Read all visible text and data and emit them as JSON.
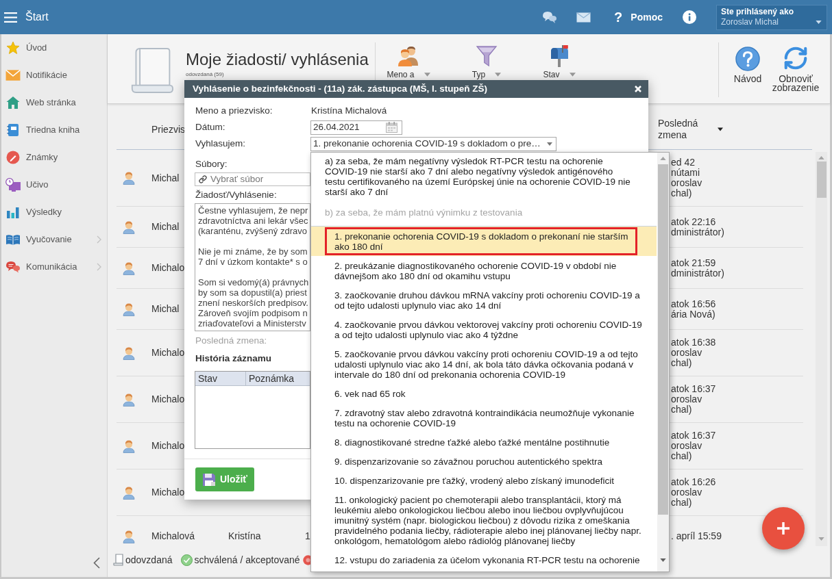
{
  "top_bar": {
    "title": "Štart",
    "help": {
      "symbol": "?",
      "label": "Pomoc"
    },
    "user": {
      "caption": "Ste prihlásený ako",
      "name": "Zoroslav Michal"
    }
  },
  "sidebar": {
    "items": [
      {
        "label": "Úvod",
        "submenu": false
      },
      {
        "label": "Notifikácie",
        "submenu": false
      },
      {
        "label": "Web stránka",
        "submenu": false
      },
      {
        "label": "Triedna kniha",
        "submenu": false
      },
      {
        "label": "Známky",
        "submenu": false
      },
      {
        "label": "Učivo",
        "submenu": false
      },
      {
        "label": "Výsledky",
        "submenu": false
      },
      {
        "label": "Vyučovanie",
        "submenu": true
      },
      {
        "label": "Komunikácia",
        "submenu": true
      }
    ]
  },
  "header": {
    "title": "Moje žiadosti/ vyhlásenia",
    "subtitle": "odovzdaná (59)",
    "filters": [
      {
        "label": "Meno a"
      },
      {
        "label": "Typ"
      },
      {
        "label": "Stav"
      }
    ],
    "actions": [
      {
        "label": "Návod"
      },
      {
        "label": "Obnoviť zobrazenie"
      }
    ]
  },
  "table": {
    "columns": [
      {
        "label": "Priezvis"
      },
      {
        "label": "Posledná zmena",
        "sorted": true
      }
    ],
    "rows": [
      {
        "surname": "Michal",
        "last_change": [
          "ed 42",
          "nútami",
          "oroslav",
          "chal)"
        ]
      },
      {
        "surname": "Michal",
        "last_change": [
          "atok 22:16",
          "dministrátor)"
        ]
      },
      {
        "surname": "Michalo",
        "last_change": [
          "atok 21:59",
          "dministrátor)"
        ]
      },
      {
        "surname": "Michal",
        "last_change": [
          "atok 16:56",
          "ária Nová)"
        ]
      },
      {
        "surname": "Michalo",
        "last_change": [
          "atok 16:38",
          "oroslav",
          "chal)"
        ]
      },
      {
        "surname": "Michalo",
        "last_change": [
          "atok 16:37",
          "oroslav",
          "chal)"
        ]
      },
      {
        "surname": "Michalo",
        "last_change": [
          "atok 16:37",
          "oroslav",
          "chal)"
        ]
      },
      {
        "surname": "Michalo",
        "last_change": [
          "atok 16:26",
          "oroslav",
          "chal)"
        ]
      },
      {
        "surname": "Michalová",
        "first_name": "Kristína",
        "number": "1",
        "last_change": [
          ". apríl 15:59"
        ]
      }
    ]
  },
  "legend": [
    {
      "kind": "document",
      "label": "odovzdaná"
    },
    {
      "kind": "check",
      "label": "schválená / akceptované"
    },
    {
      "kind": "dot"
    }
  ],
  "modal": {
    "title": "Vyhlásenie o bezinfekčnosti - (11a) zák. zástupca (MŠ, I. stupeň ZŠ)",
    "fields": [
      {
        "kind": "text",
        "label": "Meno a priezvisko:",
        "value": "Kristína Michalová"
      },
      {
        "kind": "date",
        "label": "Dátum:",
        "value": "26.04.2021"
      },
      {
        "kind": "select",
        "label": "Vyhlasujem:",
        "value": "1. prekonanie ochorenia COVID-19 s dokladom o pre…",
        "expanded": true,
        "options": [
          {
            "label": "a) za seba, že mám negatívny výsledok RT-PCR testu na ochorenie COVID-19 nie starší ako 7 dní alebo negatívny výsledok antigénového testu certifikovaného na území Európskej únie na ochorenie COVID-19 nie starší ako 7 dní",
            "selected": false
          }
        ],
        "groups": [
          {
            "label": "b) za seba, že mám platnú výnimku z testovania",
            "options": [
              {
                "label": "1. prekonanie ochorenia COVID-19 s dokladom o prekonaní nie starším ako 180 dní",
                "selected": true
              },
              {
                "label": "2. preukázanie diagnostikovaného ochorenie COVID-19 v období nie dávnejšom ako 180 dní od okamihu vstupu",
                "selected": false
              },
              {
                "label": "3. zaočkovanie druhou dávkou mRNA vakcíny proti ochoreniu COVID-19 a od tejto udalosti uplynulo viac ako 14 dní",
                "selected": false
              },
              {
                "label": "4. zaočkovanie prvou dávkou vektorovej vakcíny proti ochoreniu COVID-19 a od tejto udalosti uplynulo viac ako 4 týždne",
                "selected": false
              },
              {
                "label": "5. zaočkovanie prvou dávkou vakcíny proti ochoreniu COVID-19 a od tejto udalosti uplynulo viac ako 14 dní, ak bola táto dávka očkovania podaná v intervale do 180 dní od prekonania ochorenia COVID-19",
                "selected": false
              },
              {
                "label": "6. vek nad 65 rok",
                "selected": false
              },
              {
                "label": "7. zdravotný stav alebo zdravotná kontraindikácia neumožňuje vykonanie testu na ochorenie COVID-19",
                "selected": false
              },
              {
                "label": "8. diagnostikované stredne ťažké alebo ťažké mentálne postihnutie",
                "selected": false
              },
              {
                "label": "9. dispenzarizovanie so závažnou poruchou autentického spektra",
                "selected": false
              },
              {
                "label": "10. dispenzarizovanie pre ťažký, vrodený alebo získaný imunodeficit",
                "selected": false
              },
              {
                "label": "11. onkologický pacient po chemoterapii alebo transplantácii, ktorý má leukémiu alebo onkologickou liečbou alebo inou liečbou ovplyvňujúcou imunitný systém (napr. biologickou liečbou) z dôvodu rizika z omeškania pravidelného podania liečby, rádioterapie alebo inej plánovanej liečby napr. onkológom, hematológom alebo rádiológ plánovanej liečby",
                "selected": false
              },
              {
                "label": "12. vstupu do zariadenia za účelom vykonania RT-PCR testu na ochorenie",
                "selected": false
              }
            ]
          }
        ]
      }
    ],
    "files": {
      "label": "Súbory:",
      "placeholder": "Vybrať súbor"
    },
    "statement": {
      "label": "Žiadosť/Vyhlásenie:",
      "paragraphs": [
        [
          "Čestne vyhlasujem, že nepr",
          "zdravotníctva ani lekár všec",
          "(karanténu, zvýšený zdravo"
        ],
        [
          "Nie je mi známe, že by som",
          "7 dní v úzkom kontakte* s o"
        ],
        [
          "Som si vedomý(á) právnych",
          "by som sa dopustil(a) priest",
          "znení neskorších predpisov.",
          "Zároveň svojím podpisom n",
          "zriaďovateľovi a Ministerstv"
        ]
      ]
    },
    "last_change_label": "Posledná zmena:",
    "history": {
      "title": "História záznamu",
      "columns": [
        "Stav",
        "Poznámka"
      ]
    },
    "save_label": "Uložiť"
  }
}
